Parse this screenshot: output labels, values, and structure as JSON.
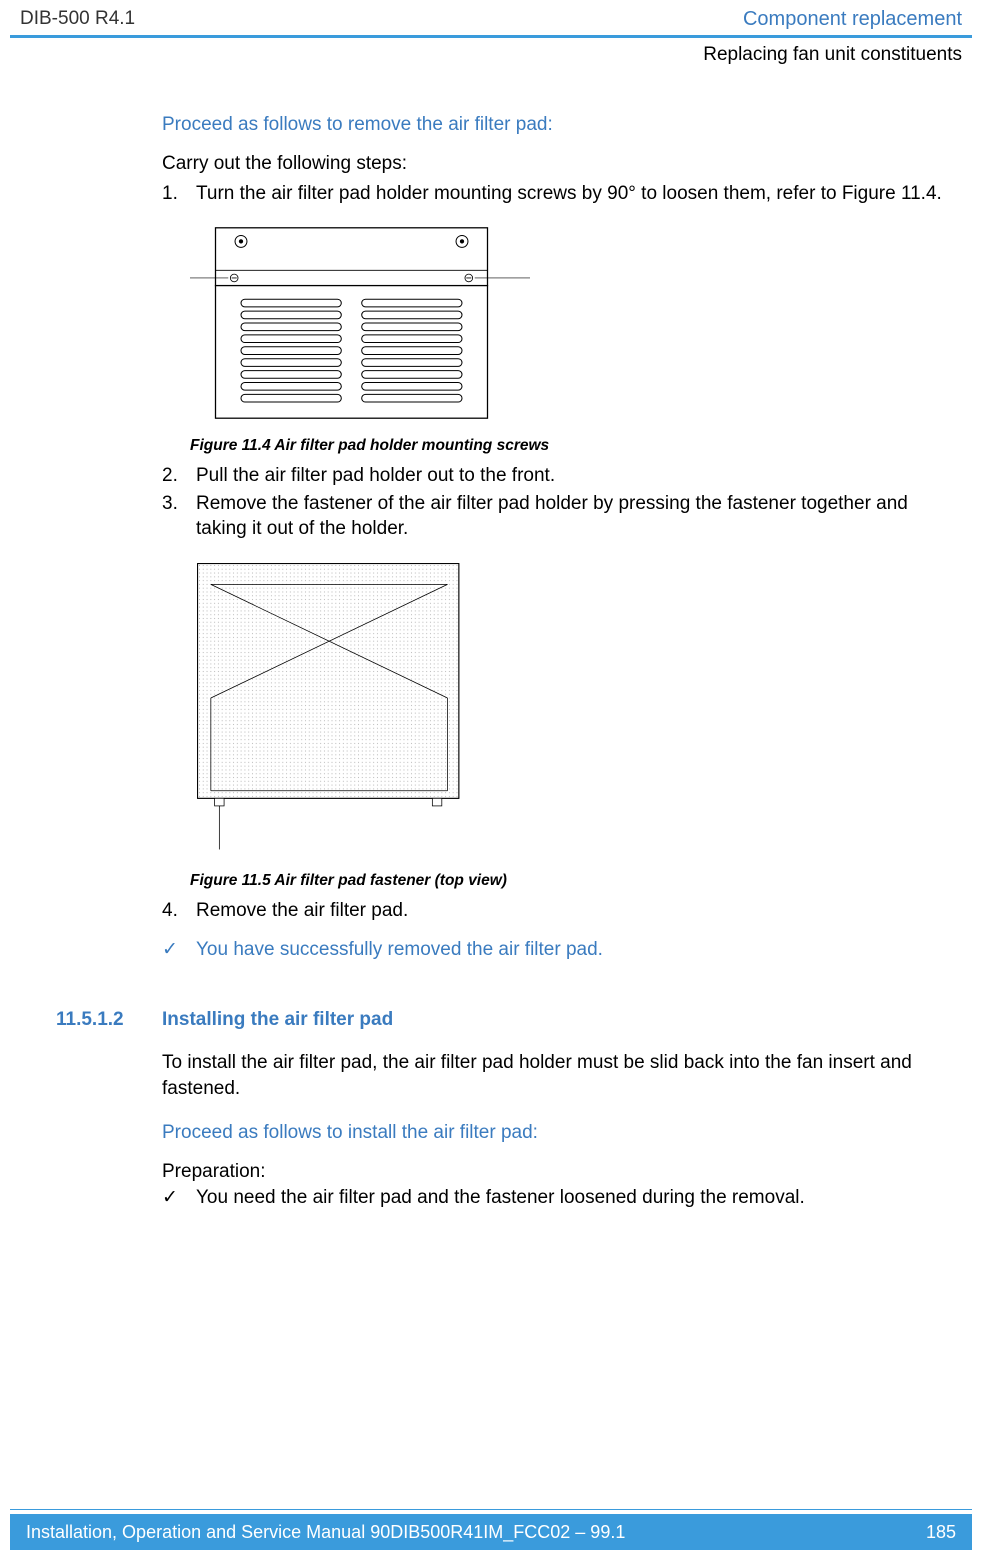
{
  "header": {
    "left": "DIB-500 R4.1",
    "right": "Component replacement",
    "sub": "Replacing fan unit constituents"
  },
  "proc1": {
    "heading": "Proceed as follows to remove the air filter pad:",
    "intro": "Carry out the following steps:",
    "steps": [
      {
        "num": "1.",
        "text": "Turn the air filter pad holder mounting screws by 90° to loosen them, refer to Figure 11.4."
      }
    ],
    "fig1_caption": "Figure 11.4 Air filter pad holder mounting screws",
    "steps2": [
      {
        "num": "2.",
        "text": "Pull the air filter pad holder out to the front."
      },
      {
        "num": "3.",
        "text": "Remove the fastener of the air filter pad holder by pressing the fastener together and taking it out of the holder."
      }
    ],
    "fig2_caption": "Figure 11.5 Air filter pad fastener (top view)",
    "steps3": [
      {
        "num": "4.",
        "text": "Remove the air filter pad."
      }
    ],
    "success": "You have successfully removed the air filter pad."
  },
  "section": {
    "num": "11.5.1.2",
    "title": "Installing the air filter pad",
    "para": "To install the air filter pad, the air filter pad holder must be slid back into the fan insert and fastened.",
    "heading": "Proceed as follows to install the air filter pad:",
    "prep_label": "Preparation:",
    "prep_item": "You need the air filter pad and the fastener loosened during the removal."
  },
  "footer": {
    "left": "Installation, Operation and Service Manual 90DIB500R41IM_FCC02 – 99.1",
    "right": "185"
  },
  "sym": {
    "check": "✓"
  }
}
